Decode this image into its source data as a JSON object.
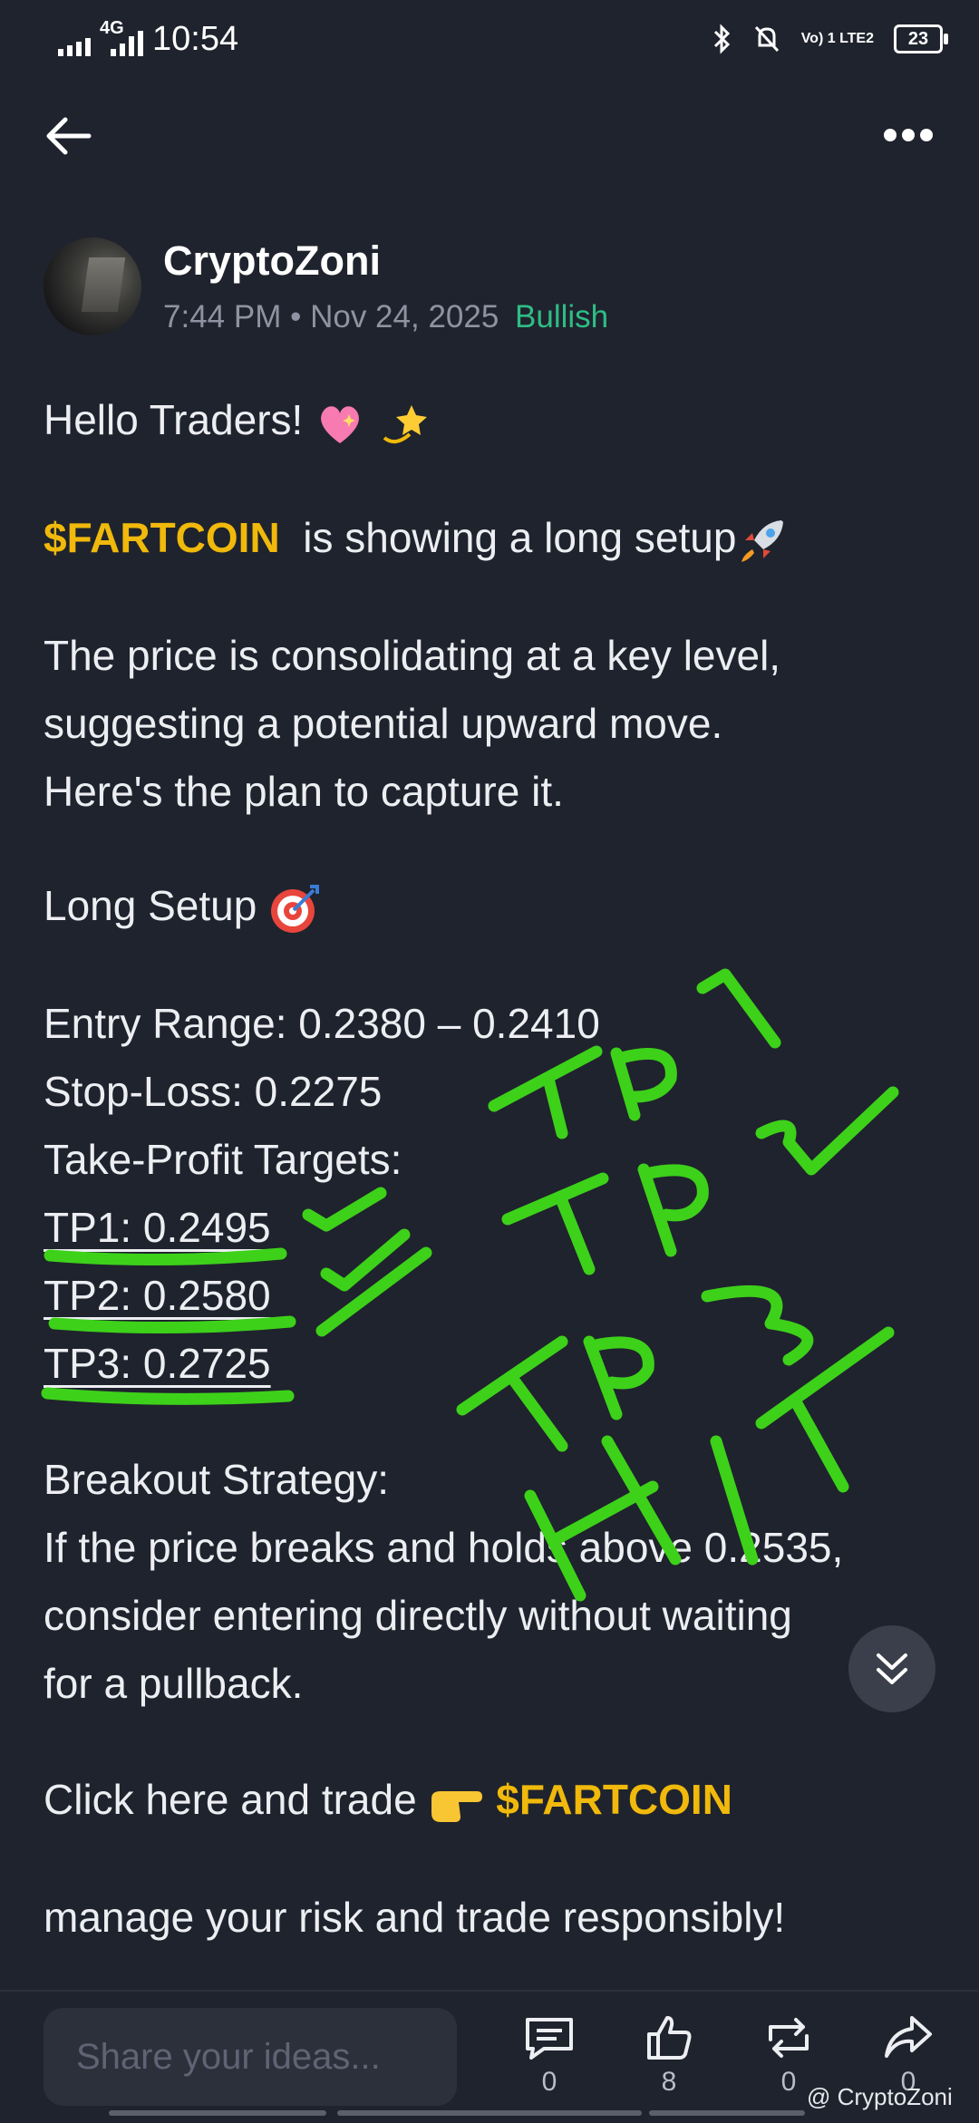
{
  "status_bar": {
    "time": "10:54",
    "network": "4G",
    "battery": "23",
    "lte": "Vo) 1 LTE2"
  },
  "author": {
    "name": "CryptoZoni",
    "time": "7:44 PM",
    "date": "Nov 24, 2025",
    "sentiment": "Bullish",
    "separator": "•"
  },
  "post": {
    "greeting": "Hello Traders!",
    "ticker": "$FARTCOIN",
    "setup_text": "is showing a long setup",
    "para1_l1": "The price is consolidating at a key level,",
    "para1_l2": "suggesting a potential upward move.",
    "para1_l3": "Here's the plan to capture it.",
    "long_setup": "Long Setup",
    "entry": "Entry Range: 0.2380 – 0.2410",
    "stop": "Stop-Loss: 0.2275",
    "tp_heading": "Take-Profit Targets:",
    "tp1": "TP1: 0.2495",
    "tp2": "TP2: 0.2580",
    "tp3": "TP3: 0.2725",
    "breakout": "Breakout Strategy:",
    "breakout_l1": "If the price breaks and holds above 0.2535,",
    "breakout_l2": "consider entering directly without waiting",
    "breakout_l3": "for a pullback.",
    "cta_text": "Click here and trade",
    "cta_ticker": "$FARTCOIN",
    "closing": "manage your risk and trade responsibly!"
  },
  "annotation": {
    "text": "TP1 TP2 TP3 HIT",
    "color": "#3dd11a"
  },
  "bottom": {
    "input_placeholder": "Share your ideas...",
    "comments": "0",
    "likes": "8",
    "reposts": "0",
    "shares": "0"
  },
  "watermark": "@ CryptoZoni",
  "colors": {
    "accent_gold": "#f0b90b",
    "bullish_green": "#2ebd85",
    "background": "#1f232d"
  }
}
